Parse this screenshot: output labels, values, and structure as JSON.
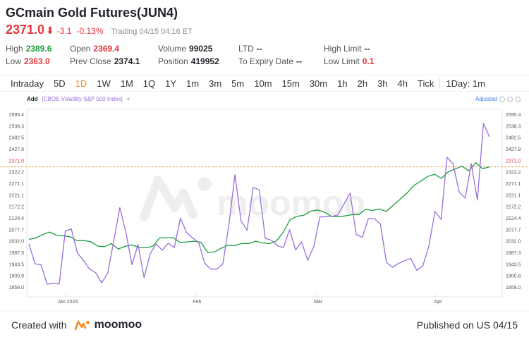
{
  "header": {
    "title": "GCmain Gold Futures(JUN4)",
    "price": "2371.0",
    "change": "-3.1",
    "change_pct": "-0.13%",
    "status": "Trading 04/15 04:16 ET",
    "arrow_icon": "down-arrow-icon"
  },
  "stats": {
    "high_label": "High",
    "high_value": "2389.6",
    "low_label": "Low",
    "low_value": "2363.0",
    "open_label": "Open",
    "open_value": "2369.4",
    "prev_close_label": "Prev Close",
    "prev_close_value": "2374.1",
    "volume_label": "Volume",
    "volume_value": "99025",
    "position_label": "Position",
    "position_value": "419952",
    "ltd_label": "LTD",
    "ltd_value": "--",
    "expiry_label": "To Expiry Date",
    "expiry_value": "--",
    "high_limit_label": "High Limit",
    "high_limit_value": "--",
    "low_limit_label": "Low Limit",
    "low_limit_value": "0.1"
  },
  "toolbar": {
    "intraday": "Intraday",
    "d5": "5D",
    "d1": "1D",
    "w1": "1W",
    "mo1": "1M",
    "q1": "1Q",
    "y1": "1Y",
    "m1": "1m",
    "m3": "3m",
    "m5": "5m",
    "m10": "10m",
    "m15": "15m",
    "m30": "30m",
    "h1": "1h",
    "h2": "2h",
    "h3": "3h",
    "h4": "4h",
    "tick": "Tick",
    "day1m": "1Day: 1m",
    "active": "1D"
  },
  "indicator_bar": {
    "add_label": "Add",
    "indicator": "[CBOE Volatility S&P 500 Index]",
    "close": "×",
    "adjusted": "Adjusted"
  },
  "watermark": "moomoo",
  "chart_data": {
    "type": "line",
    "x": [
      "Jan 2024",
      "Feb",
      "Mar",
      "Apr"
    ],
    "y_ticks": [
      "2595.4",
      "2538.3",
      "2482.5",
      "2427.8",
      "2371.0",
      "2322.2",
      "2271.1",
      "2221.1",
      "2172.2",
      "2124.4",
      "2077.7",
      "2032.0",
      "1987.3",
      "1943.5",
      "1900.8",
      "1859.0"
    ],
    "ylim": [
      1859.0,
      2595.4
    ],
    "current_price_line": 2371.0,
    "current_price_label": "2371.0",
    "series": [
      {
        "color": "#1a9c3a",
        "values": [
          2062,
          2068,
          2082,
          2093,
          2080,
          2077,
          2073,
          2056,
          2057,
          2052,
          2033,
          2031,
          2044,
          2021,
          2032,
          2038,
          2027,
          2026,
          2032,
          2068,
          2068,
          2069,
          2049,
          2051,
          2054,
          2050,
          2006,
          2008,
          2025,
          2037,
          2035,
          2045,
          2044,
          2054,
          2047,
          2044,
          2055,
          2092,
          2147,
          2160,
          2165,
          2182,
          2187,
          2178,
          2160,
          2158,
          2162,
          2167,
          2168,
          2190,
          2185,
          2191,
          2181,
          2208,
          2233,
          2259,
          2292,
          2310,
          2330,
          2339,
          2322,
          2350,
          2362,
          2374,
          2354,
          2389,
          2363,
          2371
        ]
      },
      {
        "color": "#9a6ddb",
        "values": [
          2043,
          1958,
          1953,
          1871,
          1874,
          1872,
          2098,
          2106,
          2004,
          1972,
          1935,
          1920,
          1877,
          1917,
          2056,
          2197,
          2092,
          1954,
          2040,
          1898,
          2000,
          2042,
          2016,
          2045,
          2027,
          2152,
          2092,
          2068,
          2049,
          1960,
          1935,
          1935,
          1957,
          2123,
          2338,
          2141,
          2101,
          2283,
          2273,
          2066,
          2058,
          2035,
          2027,
          2103,
          2017,
          2051,
          1973,
          2030,
          2157,
          2159,
          2160,
          2166,
          2213,
          2259,
          2083,
          2070,
          2150,
          2150,
          2127,
          1963,
          1943,
          1959,
          1971,
          1981,
          1930,
          1949,
          2034,
          2181,
          2147,
          2412,
          2383,
          2264,
          2238,
          2385,
          2229,
          2556,
          2499
        ]
      }
    ]
  }
}
